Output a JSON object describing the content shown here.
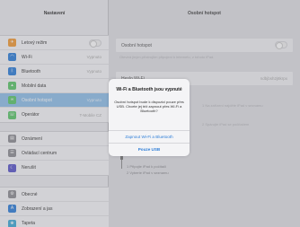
{
  "status_bar": {
    "left": "iPad Veriza 3G",
    "time": ""
  },
  "sidebar": {
    "title": "Nastavení",
    "groups": [
      {
        "items": [
          {
            "label": "Letový režim",
            "value": "",
            "icon": "airplane-icon",
            "color": "#f29a35"
          },
          {
            "label": "Wi-Fi",
            "value": "Vypnuto",
            "icon": "wifi-icon",
            "color": "#2f7fd8"
          },
          {
            "label": "Bluetooth",
            "value": "Vypnuto",
            "icon": "bluetooth-icon",
            "color": "#2f7fd8"
          },
          {
            "label": "Mobilní data",
            "value": "",
            "icon": "cellular-icon",
            "color": "#5cc66a"
          },
          {
            "label": "Osobní hotspot",
            "value": "Vypnuto",
            "icon": "hotspot-icon",
            "color": "#5cc66a"
          },
          {
            "label": "Operátor",
            "value": "T-Mobile CZ",
            "icon": "carrier-icon",
            "color": "#5cc66a"
          }
        ]
      },
      {
        "items": [
          {
            "label": "Oznámení",
            "value": "",
            "icon": "notifications-icon",
            "color": "#8e8e93"
          },
          {
            "label": "Ovládací centrum",
            "value": "",
            "icon": "control-center-icon",
            "color": "#8e8e93"
          },
          {
            "label": "Nerušit",
            "value": "",
            "icon": "moon-icon",
            "color": "#5a57c9"
          }
        ]
      },
      {
        "items": [
          {
            "label": "Obecné",
            "value": "",
            "icon": "gear-icon",
            "color": "#8e8e93"
          },
          {
            "label": "Zobrazení a jas",
            "value": "",
            "icon": "display-icon",
            "color": "#2f7fd8"
          },
          {
            "label": "Tapeta",
            "value": "",
            "icon": "wallpaper-icon",
            "color": "#3fa9d6"
          }
        ]
      }
    ]
  },
  "main": {
    "title": "Osobní hotspot",
    "back": "",
    "hotspot_row_label": "Osobní hotspot",
    "hotspot_desc": "Otevírá jiným přístrojům připojení k internetu, z tohoto iPad.",
    "wifi_pw_label": "Heslo Wi-Fi",
    "wifi_pw_value": "ndbjbsh2j8krpx",
    "connect_header": "PŘIPOJIT PŘES WI-FI",
    "connect_wifi": "1 Na zařízení najděte iPad v seznamu",
    "connect_bt": "2 Spárujte iPad se počítačem",
    "connect_usb": "1 Připojte iPad k počítači",
    "connect_usb2": "2 Vyberte iPad v seznamu"
  },
  "alert": {
    "title": "Wi-Fi a Bluetooth jsou vypnuté",
    "message": "Osobní hotspot bude k dispozici pouze přes USB. Chcete jej též zapnout přes Wi-Fi a Bluetooth?",
    "buttons": [
      {
        "label": "Zapnout Wi-Fi a Bluetooth",
        "bold": false
      },
      {
        "label": "Pouze USB",
        "bold": true
      }
    ]
  }
}
